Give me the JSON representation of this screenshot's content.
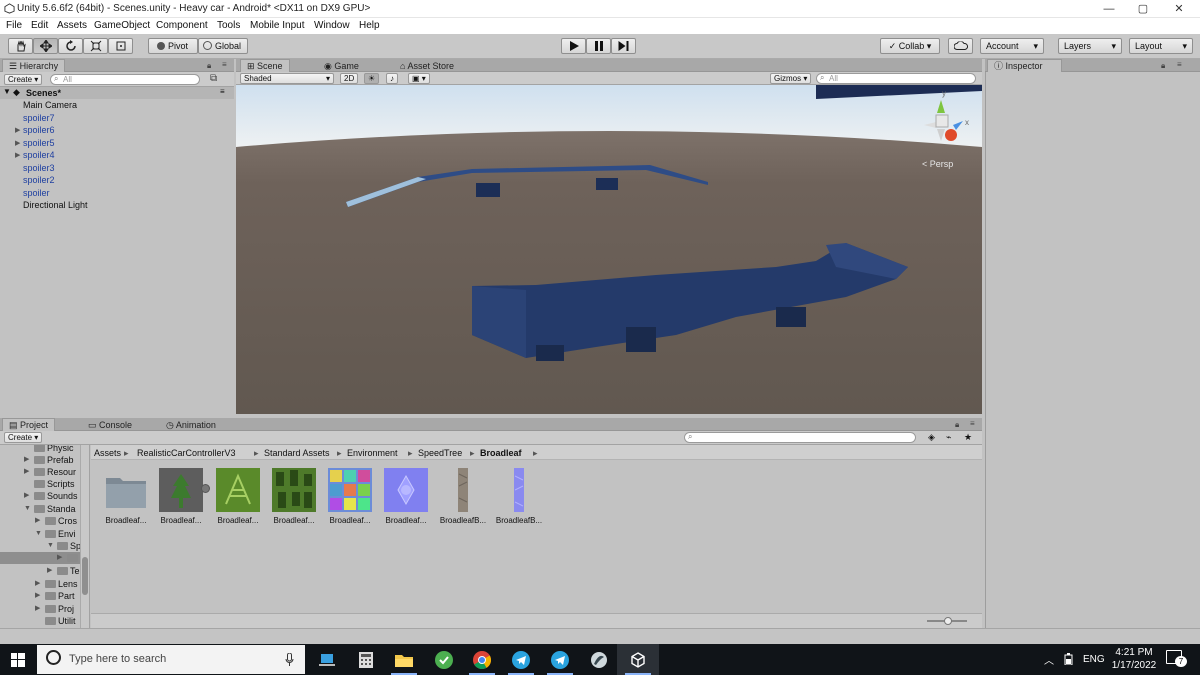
{
  "window": {
    "title": "Unity 5.6.6f2 (64bit) - Scenes.unity - Heavy car - Android* <DX11 on DX9 GPU>"
  },
  "menu": [
    "File",
    "Edit",
    "Assets",
    "GameObject",
    "Component",
    "Tools",
    "Mobile Input",
    "Window",
    "Help"
  ],
  "toolbar": {
    "pivot": "Pivot",
    "global": "Global",
    "collab": "Collab ▾",
    "account": "Account",
    "layers": "Layers",
    "layout": "Layout"
  },
  "hierarchy": {
    "tab": "Hierarchy",
    "create": "Create ▾",
    "search_placeholder": "All",
    "scene": "Scenes*",
    "items": [
      {
        "label": "Main Camera",
        "blue": false,
        "expandable": false
      },
      {
        "label": "spoiler7",
        "blue": true,
        "expandable": false
      },
      {
        "label": "spoiler6",
        "blue": true,
        "expandable": true
      },
      {
        "label": "spoiler5",
        "blue": true,
        "expandable": true
      },
      {
        "label": "spoiler4",
        "blue": true,
        "expandable": true
      },
      {
        "label": "spoiler3",
        "blue": true,
        "expandable": false
      },
      {
        "label": "spoiler2",
        "blue": true,
        "expandable": false
      },
      {
        "label": "spoiler",
        "blue": true,
        "expandable": false
      },
      {
        "label": "Directional Light",
        "blue": false,
        "expandable": false
      }
    ]
  },
  "scene": {
    "tabs": [
      "Scene",
      "Game",
      "Asset Store"
    ],
    "shading": "Shaded",
    "mode2d": "2D",
    "gizmos": "Gizmos ▾",
    "search_placeholder": "All",
    "persp": "< Persp",
    "gizmo_axes": {
      "y": "y",
      "x": "x"
    }
  },
  "inspector": {
    "tab": "Inspector"
  },
  "project": {
    "tabs": [
      "Project",
      "Console",
      "Animation"
    ],
    "create": "Create ▾",
    "breadcrumb": [
      "Assets",
      "RealisticCarControllerV3",
      "Standard Assets",
      "Environment",
      "SpeedTree",
      "Broadleaf"
    ],
    "tree": [
      "Physic",
      "Prefab",
      "Resour",
      "Scripts",
      "Sounds",
      "Standa",
      "Cros",
      "Envi",
      "Sp",
      "",
      "Te",
      "Lens",
      "Part",
      "Proj",
      "Utilit"
    ],
    "assets": [
      "Broadleaf...",
      "Broadleaf...",
      "Broadleaf...",
      "Broadleaf...",
      "Broadleaf...",
      "Broadleaf...",
      "BroadleafB...",
      "BroadleafB..."
    ]
  },
  "taskbar": {
    "search_placeholder": "Type here to search",
    "lang": "ENG",
    "time": "4:21 PM",
    "date": "1/17/2022",
    "notifications": "7"
  },
  "colors": {
    "sky": "#d8e4ee",
    "ground": "#6b5f55",
    "spoiler": "#243a66",
    "accent": "#1e3fa0"
  }
}
